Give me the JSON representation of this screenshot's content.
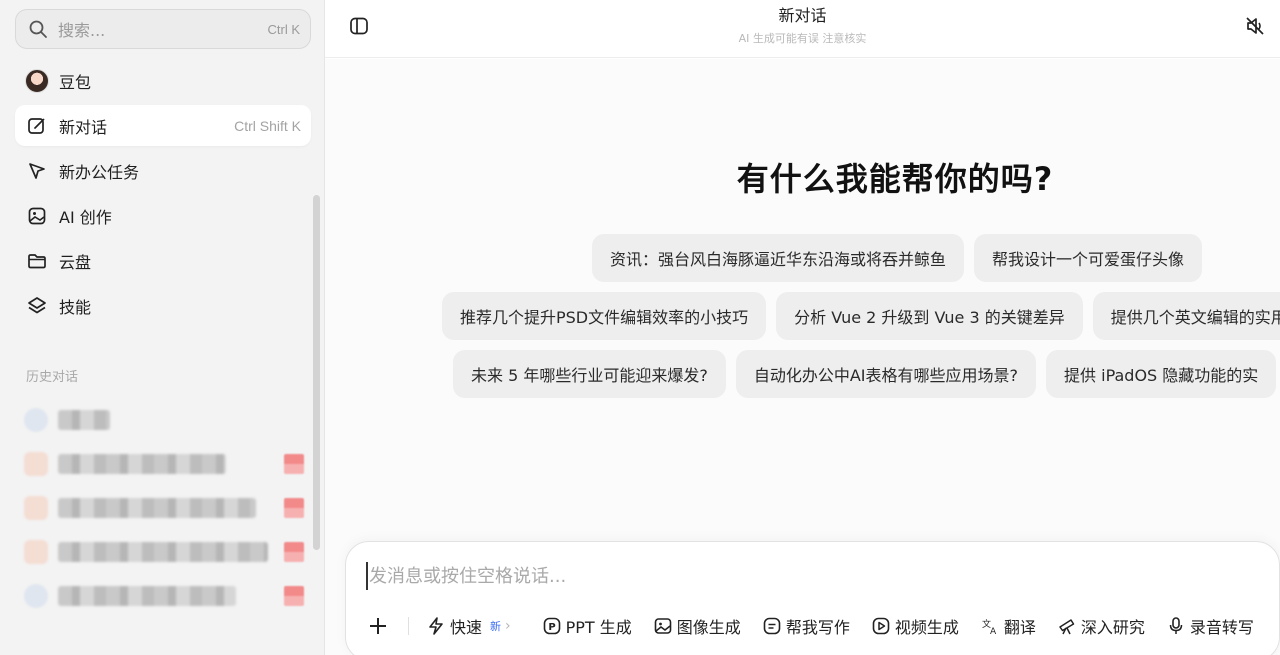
{
  "search": {
    "placeholder": "搜索...",
    "shortcut": "Ctrl K"
  },
  "nav": [
    {
      "label": "豆包",
      "shortcut": "",
      "icon": "doubao-avatar"
    },
    {
      "label": "新对话",
      "shortcut": "Ctrl Shift K",
      "icon": "edit-icon"
    },
    {
      "label": "新办公任务",
      "shortcut": "",
      "icon": "office-task-icon"
    },
    {
      "label": "AI 创作",
      "shortcut": "",
      "icon": "image-create-icon"
    },
    {
      "label": "云盘",
      "shortcut": "",
      "icon": "folder-icon"
    },
    {
      "label": "技能",
      "shortcut": "",
      "icon": "layers-icon"
    }
  ],
  "history": {
    "title": "历史对话"
  },
  "header": {
    "title": "新对话",
    "subtitle": "AI 生成可能有误 注意核实"
  },
  "main": {
    "hero": "有什么我能帮你的吗?",
    "suggestions": [
      [
        "资讯：强台风白海豚逼近华东沿海或将吞并鲸鱼",
        "帮我设计一个可爱蛋仔头像"
      ],
      [
        "推荐几个提升PSD文件编辑效率的小技巧",
        "分析 Vue 2 升级到 Vue 3 的关键差异",
        "提供几个英文编辑的实用"
      ],
      [
        "未来 5 年哪些行业可能迎来爆发?",
        "自动化办公中AI表格有哪些应用场景?",
        "提供 iPadOS 隐藏功能的实"
      ]
    ]
  },
  "composer": {
    "placeholder": "发消息或按住空格说话...",
    "tools": {
      "quick": "快速",
      "quick_badge": "新",
      "ppt": "PPT 生成",
      "image": "图像生成",
      "write": "帮我写作",
      "video": "视频生成",
      "translate": "翻译",
      "research": "深入研究",
      "record": "录音转写"
    }
  },
  "colors": {
    "accent": "#3b6df0",
    "sidebar_bg": "#f3f3f3",
    "chip_bg": "#eeeeee"
  }
}
